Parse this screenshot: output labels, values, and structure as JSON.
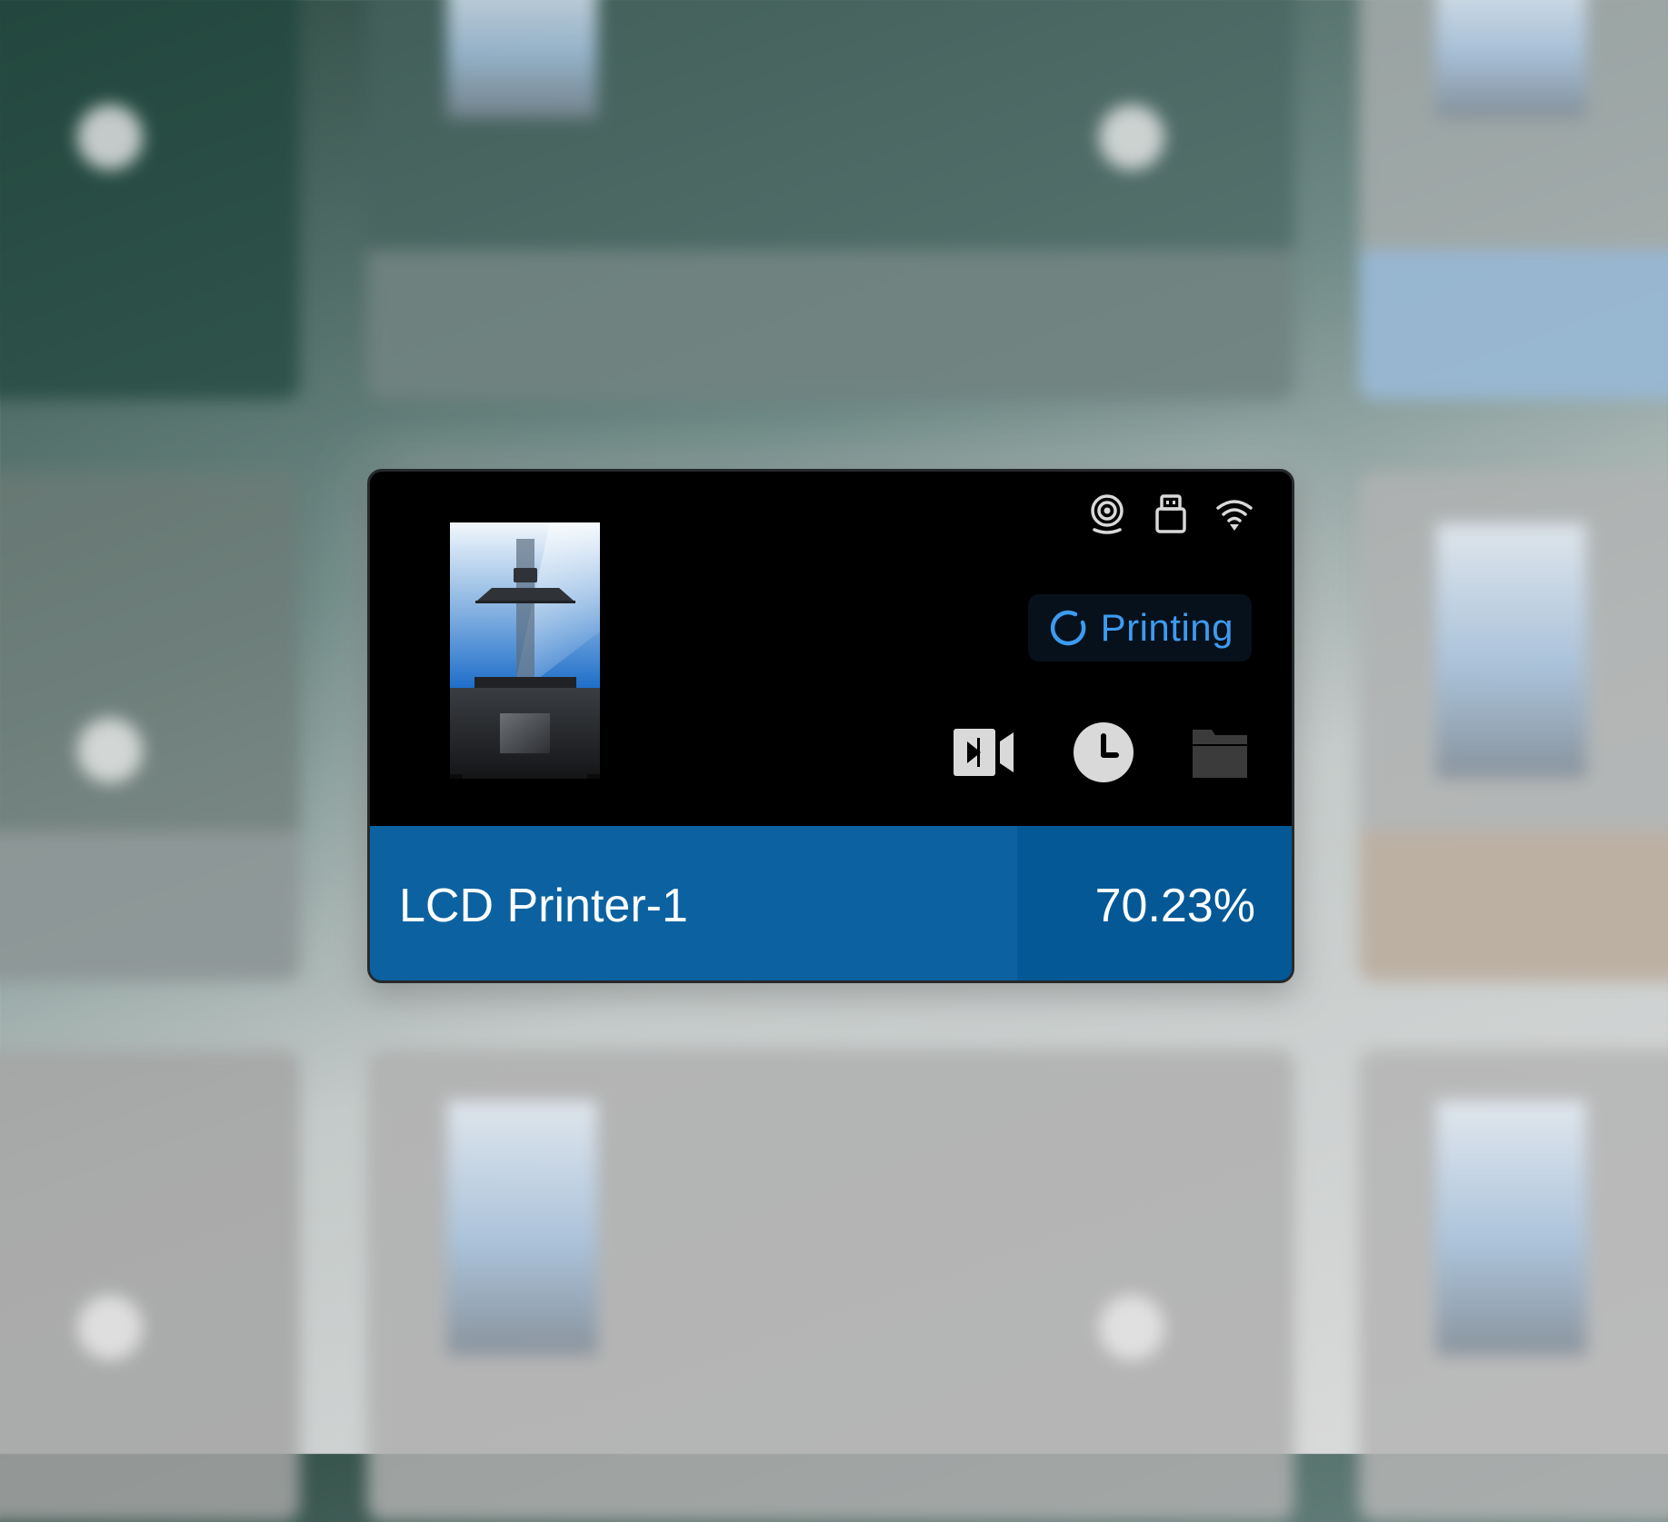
{
  "card": {
    "printer_name": "LCD Printer-1",
    "status": "Printing",
    "progress_text": "70.23%",
    "progress": 0.7023,
    "status_icons": [
      "webcam-icon",
      "usb-drive-icon",
      "wifi-icon"
    ],
    "action_icons": [
      "video-icon",
      "clock-icon",
      "folder-icon"
    ],
    "colors": {
      "footer": "#0c62a0",
      "footer_remaining": "#045896",
      "status_text": "#3d9bf0",
      "status_bg": "#07111c",
      "card_bg": "#000000",
      "icon": "#d9d9d9"
    }
  }
}
